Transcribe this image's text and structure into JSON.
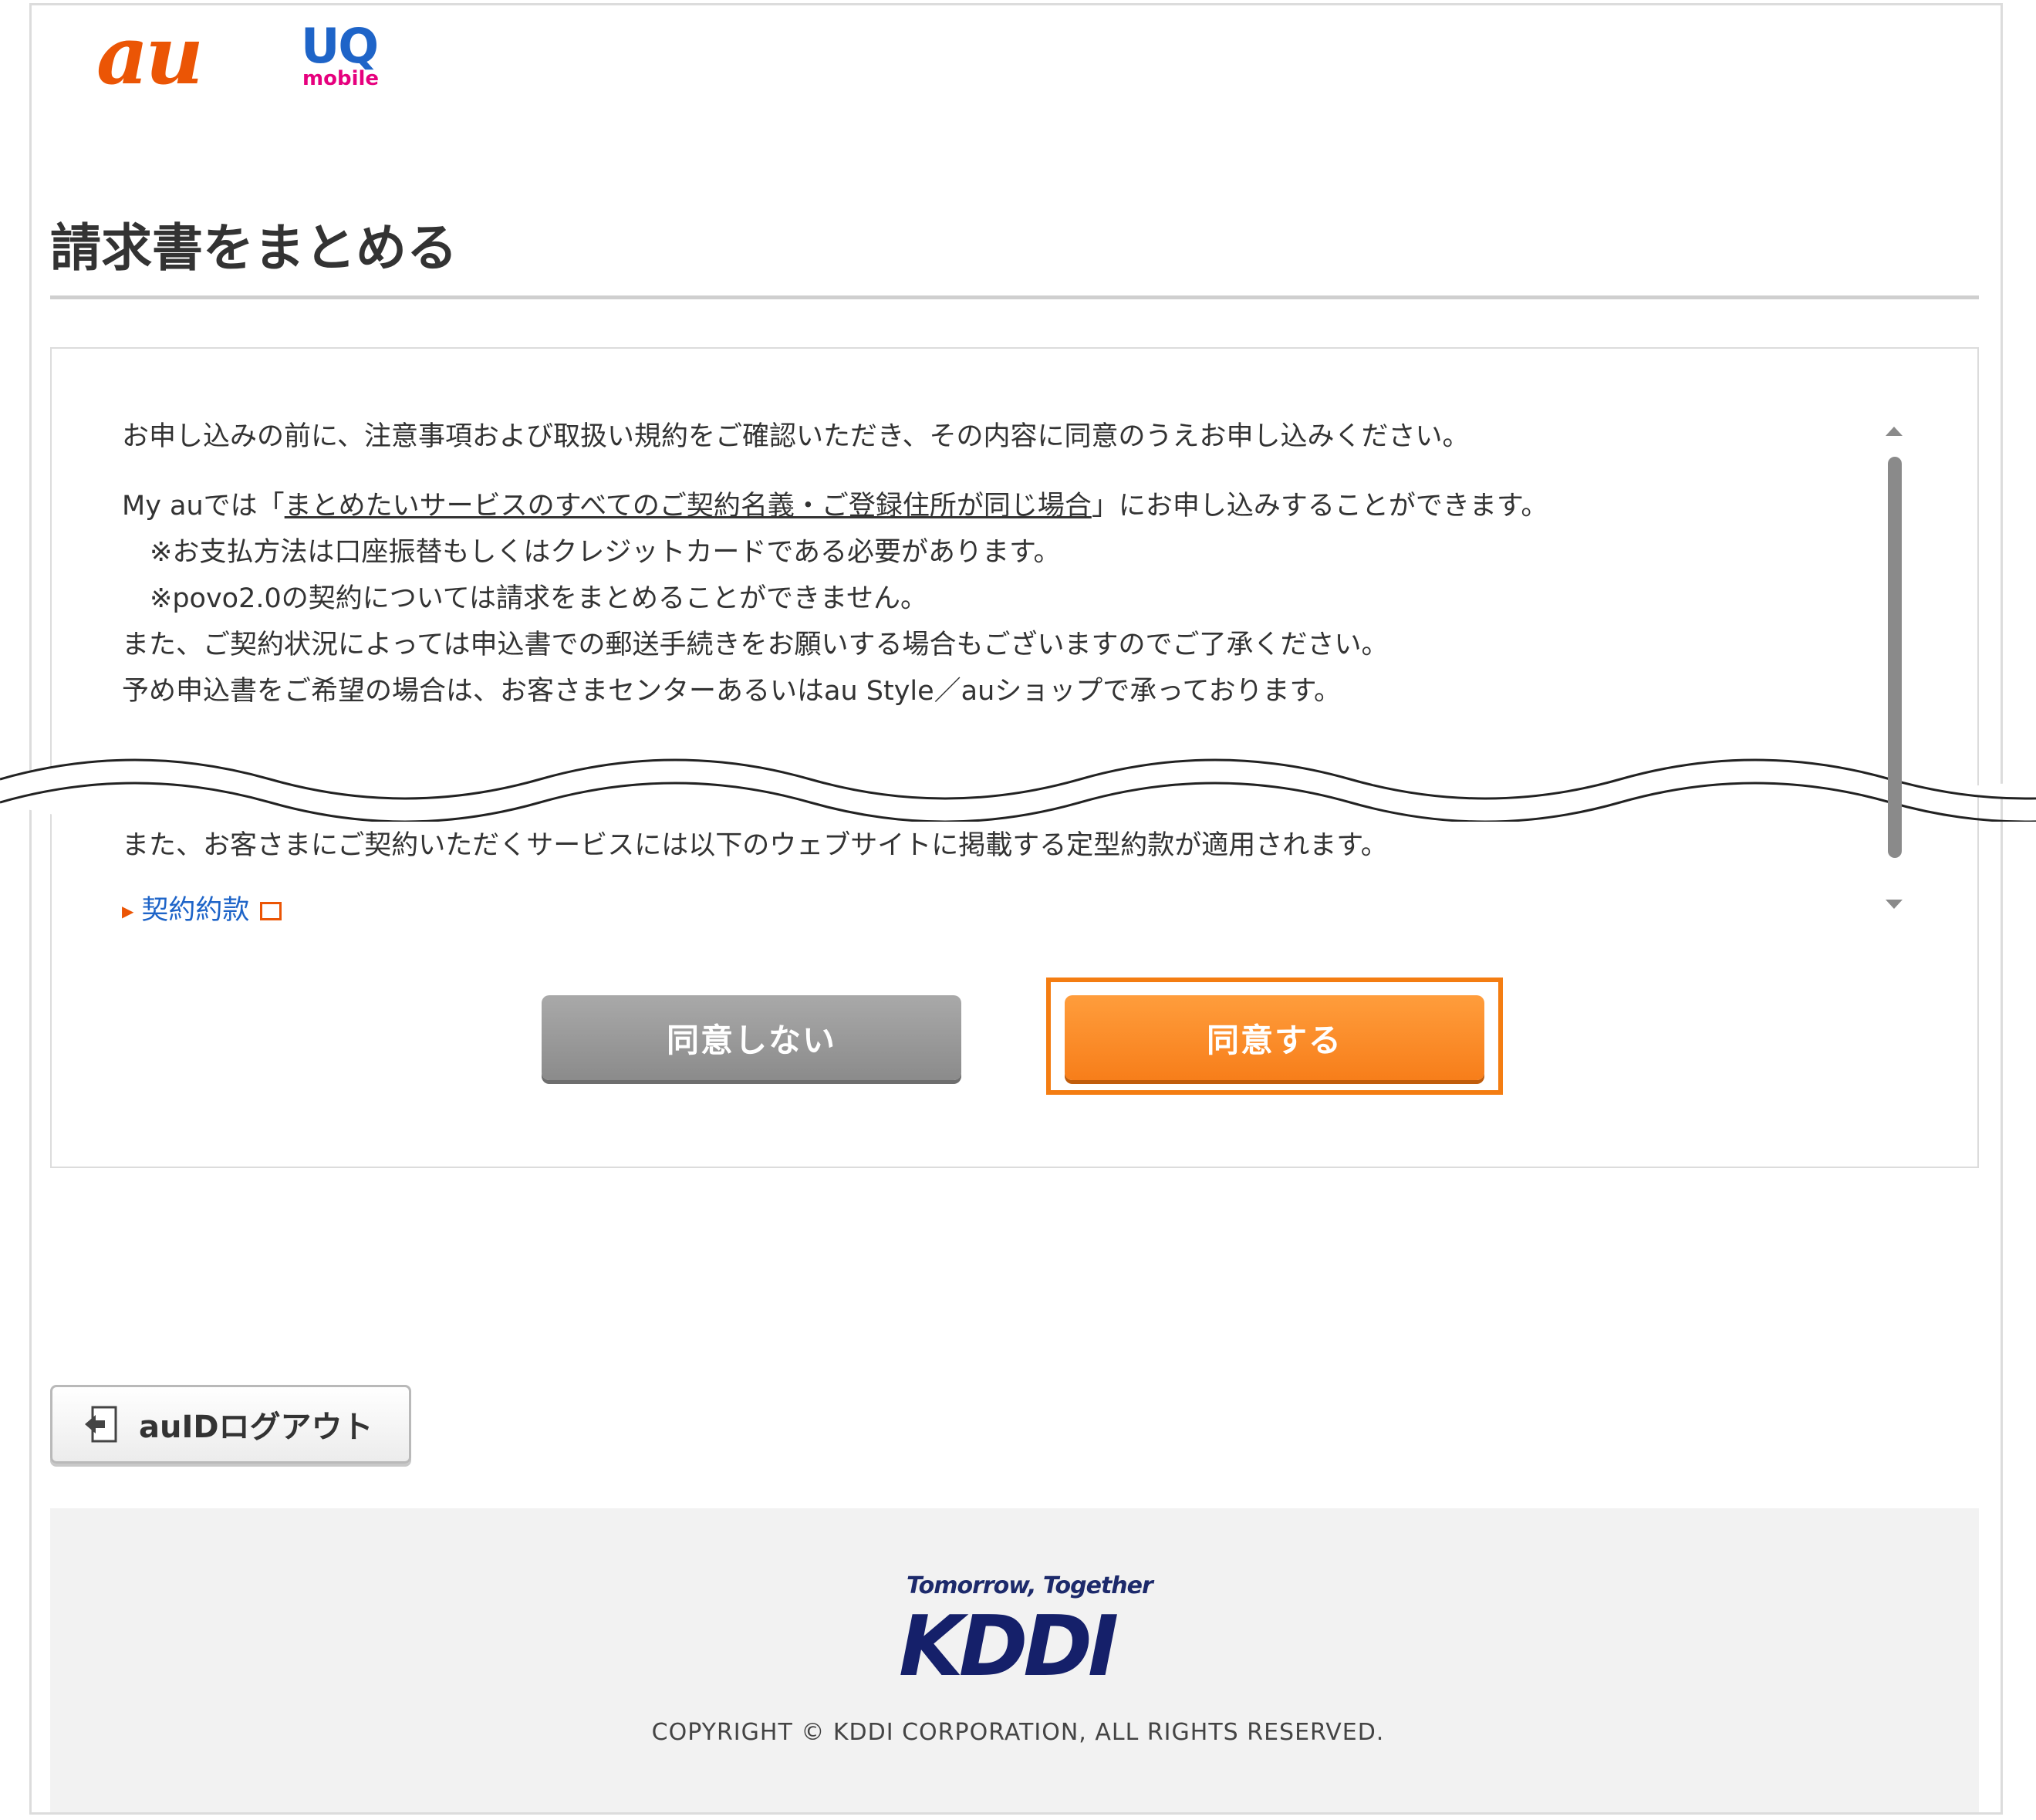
{
  "header": {
    "logo_au": "au",
    "logo_uq": "UQ",
    "logo_uq_sub": "mobile"
  },
  "page": {
    "title": "請求書をまとめる"
  },
  "terms": {
    "intro": "お申し込みの前に、注意事項および取扱い規約をご確認いただき、その内容に同意のうえお申し込みください。",
    "line2_prefix": "My auでは「",
    "line2_underlined": "まとめたいサービスのすべてのご契約名義・ご登録住所が同じ場合",
    "line2_suffix": "」にお申し込みすることができます。",
    "note1": "※お支払方法は口座振替もしくはクレジットカードである必要があります。",
    "note2": "※povo2.0の契約については請求をまとめることができません。",
    "line5": "また、ご契約状況によっては申込書での郵送手続きをお願いする場合もございますのでご了承ください。",
    "line6": "予め申込書をご希望の場合は、お客さまセンターあるいはau Style／auショップで承っております。",
    "line7": "また、お客さまにご契約いただくサービスには以下のウェブサイトに掲載する定型約款が適用されます。",
    "link_contract": "契約約款"
  },
  "buttons": {
    "disagree": "同意しない",
    "agree": "同意する",
    "logout": "auIDログアウト"
  },
  "footer": {
    "tagline": "Tomorrow, Together",
    "brand": "KDDI",
    "copyright": "COPYRIGHT © KDDI CORPORATION, ALL RIGHTS RESERVED."
  },
  "colors": {
    "au_orange": "#eb5505",
    "agree_button": "#f88a27",
    "disagree_button": "#999999",
    "highlight_border": "#f47d12",
    "link_blue": "#1e64c8",
    "kddi_navy": "#15206a"
  }
}
